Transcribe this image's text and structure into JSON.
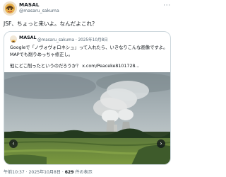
{
  "author": {
    "name": "MASAL",
    "handle": "@masaru_sakuma"
  },
  "tweet": {
    "text": "JSF、ちょっと来いよ。なんだよこれ？"
  },
  "quote": {
    "name": "MASAL",
    "handle": "@masaru_sakuma · 2025年10月8日",
    "line1": "Googleで「ノヴォヴォロネシュ」って入れたら、いきなりこんな画像ですよ。",
    "line2": "MAPでも削りめっちゃ修正し。",
    "line3_text": "他にどこ削ったというのだろうか？ ",
    "line3_link": "x.com/Peaceke8101728..."
  },
  "meta": {
    "time": "午前10:37 · 2025年10月8日 · ",
    "views_count": "629",
    "views_label": " 件の表示"
  },
  "icons": {
    "more": "more-horizontal-icon",
    "prev": "chevron-left-icon",
    "next": "chevron-right-icon"
  },
  "colors": {
    "text": "#0f1419",
    "secondary": "#536471",
    "border": "#cfd9de"
  }
}
